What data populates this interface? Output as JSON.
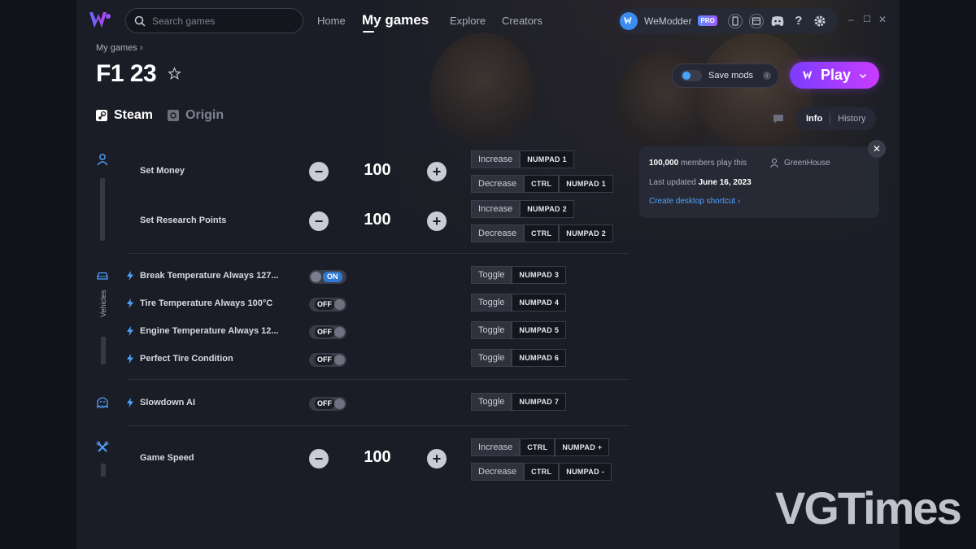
{
  "app": {
    "brand_color": "#7b3cff",
    "icon": "wemodder-logo"
  },
  "search": {
    "placeholder": "Search games"
  },
  "nav": {
    "home": "Home",
    "my_games": "My games",
    "explore": "Explore",
    "creators": "Creators"
  },
  "account": {
    "name": "WeModder",
    "badge": "PRO"
  },
  "window": {
    "minimize": "–",
    "maximize": "☐",
    "close": "✕"
  },
  "breadcrumb": {
    "label": "My games",
    "sep": "›"
  },
  "game": {
    "title": "F1 23"
  },
  "platforms": [
    {
      "label": "Steam",
      "active": true
    },
    {
      "label": "Origin",
      "active": false
    }
  ],
  "actions": {
    "save_mods": "Save mods",
    "info_glyph": "i",
    "play": "Play"
  },
  "tabs": {
    "info": "Info",
    "history": "History",
    "active": "info"
  },
  "info_card": {
    "members": "100,000",
    "members_suffix": "members play this",
    "author": "GreenHouse",
    "updated_prefix": "Last updated",
    "updated_date": "June 16, 2023",
    "shortcut": "Create desktop shortcut ›"
  },
  "categories": {
    "vehicles": "Vehicles"
  },
  "mods": [
    {
      "name": "Set Money",
      "type": "number",
      "value": "100",
      "keys": [
        {
          "action": "Increase",
          "combo": [
            "NUMPAD 1"
          ]
        },
        {
          "action": "Decrease",
          "combo": [
            "CTRL",
            "NUMPAD 1"
          ]
        }
      ]
    },
    {
      "name": "Set Research Points",
      "type": "number",
      "value": "100",
      "keys": [
        {
          "action": "Increase",
          "combo": [
            "NUMPAD 2"
          ]
        },
        {
          "action": "Decrease",
          "combo": [
            "CTRL",
            "NUMPAD 2"
          ]
        }
      ]
    },
    {
      "name": "Break Temperature Always 127...",
      "type": "toggle",
      "state": "ON",
      "keys": [
        {
          "action": "Toggle",
          "combo": [
            "NUMPAD 3"
          ]
        }
      ]
    },
    {
      "name": "Tire Temperature Always 100°C",
      "type": "toggle",
      "state": "OFF",
      "keys": [
        {
          "action": "Toggle",
          "combo": [
            "NUMPAD 4"
          ]
        }
      ]
    },
    {
      "name": "Engine Temperature Always 12...",
      "type": "toggle",
      "state": "OFF",
      "keys": [
        {
          "action": "Toggle",
          "combo": [
            "NUMPAD 5"
          ]
        }
      ]
    },
    {
      "name": "Perfect Tire Condition",
      "type": "toggle",
      "state": "OFF",
      "keys": [
        {
          "action": "Toggle",
          "combo": [
            "NUMPAD 6"
          ]
        }
      ]
    },
    {
      "name": "Slowdown AI",
      "type": "toggle",
      "state": "OFF",
      "keys": [
        {
          "action": "Toggle",
          "combo": [
            "NUMPAD 7"
          ]
        }
      ]
    },
    {
      "name": "Game Speed",
      "type": "number",
      "value": "100",
      "keys": [
        {
          "action": "Increase",
          "combo": [
            "CTRL",
            "NUMPAD +"
          ]
        },
        {
          "action": "Decrease",
          "combo": [
            "CTRL",
            "NUMPAD -"
          ]
        }
      ]
    }
  ],
  "watermark": "VGTimes"
}
